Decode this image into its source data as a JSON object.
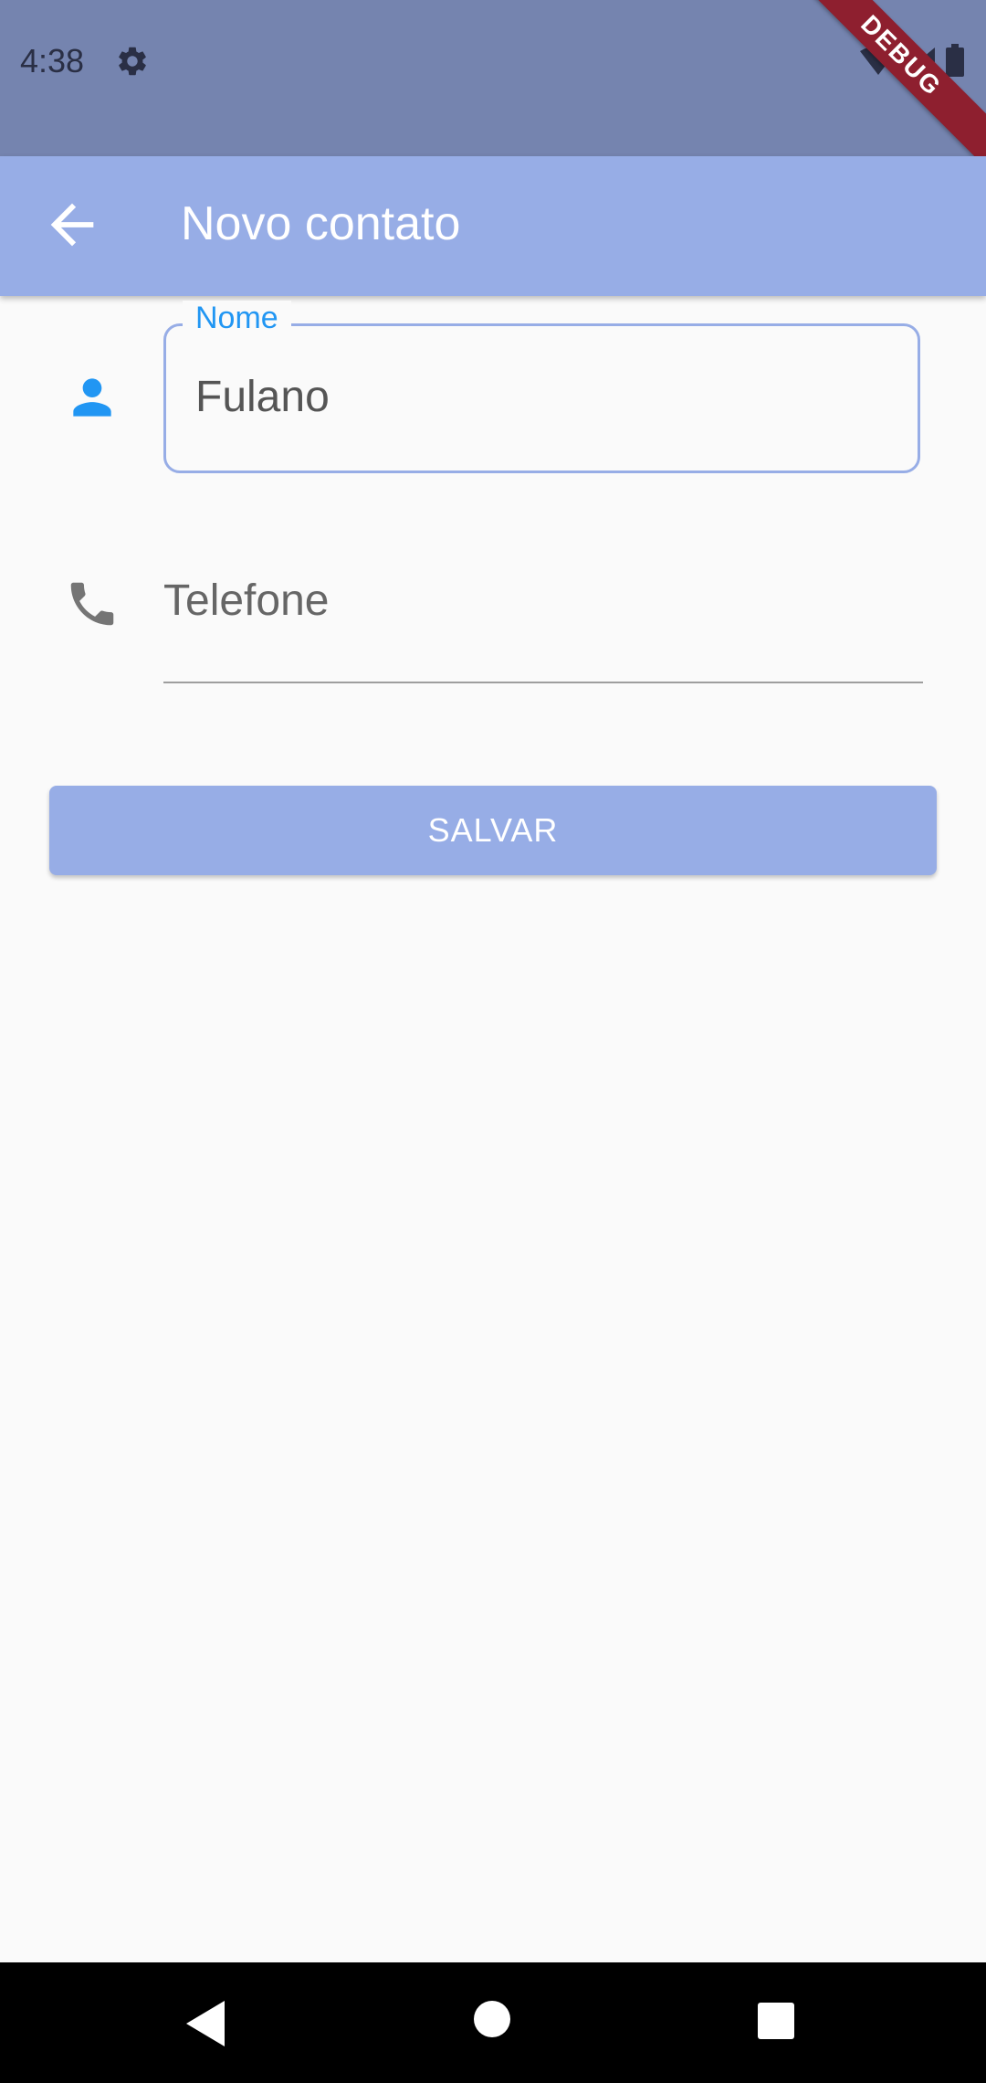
{
  "status_bar": {
    "time": "4:38",
    "debug_label": "DEBUG"
  },
  "app_bar": {
    "title": "Novo contato"
  },
  "form": {
    "name": {
      "label": "Nome",
      "value": "Fulano"
    },
    "phone": {
      "placeholder": "Telefone"
    },
    "save_label": "SALVAR"
  },
  "icons": {
    "settings": "gear-icon",
    "back": "arrow-back-icon",
    "person": "person-icon",
    "phone": "phone-icon"
  },
  "colors": {
    "status_bar": "#7584af",
    "app_bar": "#97ade6",
    "accent": "#2196f3",
    "button": "#97ade6",
    "debug_banner": "#8e1f2f"
  }
}
